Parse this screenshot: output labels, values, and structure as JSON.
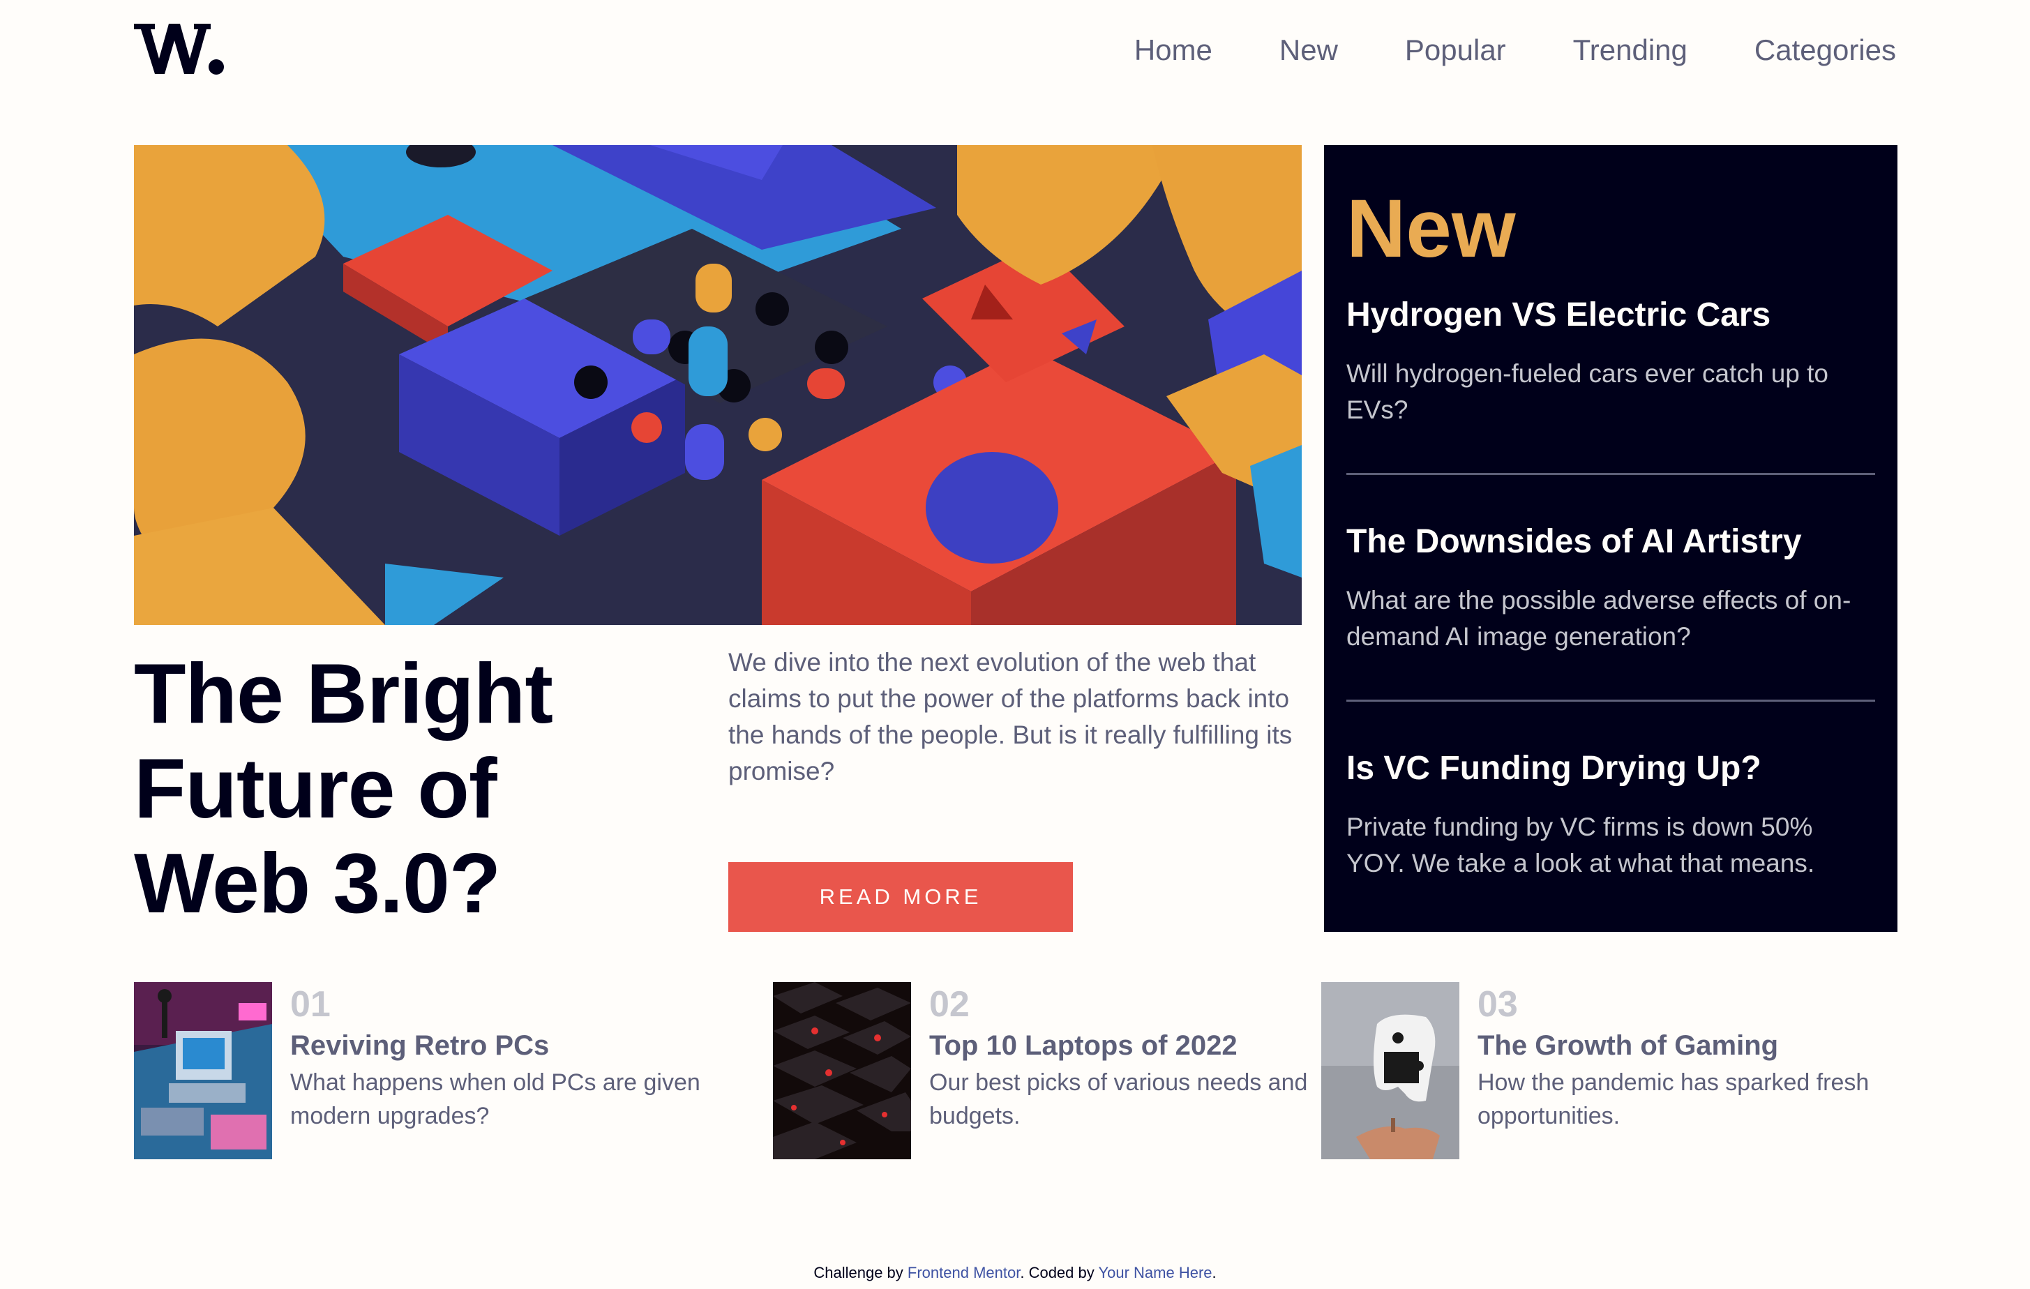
{
  "header": {
    "logo_text": "W.",
    "nav": [
      "Home",
      "New",
      "Popular",
      "Trending",
      "Categories"
    ]
  },
  "hero": {
    "image_icon": "abstract-3d-blocks-image",
    "title": "The Bright Future of Web 3.0?",
    "description": "We dive into the next evolution of the web that claims to put the power of the platforms back into the hands of the people. But is it really fulfilling its promise?",
    "button_label": "READ MORE"
  },
  "new_panel": {
    "heading": "New",
    "items": [
      {
        "title": "Hydrogen VS Electric Cars",
        "text": "Will hydrogen-fueled cars ever catch up to EVs?"
      },
      {
        "title": "The Downsides of AI Artistry",
        "text": "What are the possible adverse effects of on-demand AI image generation?"
      },
      {
        "title": "Is VC Funding Drying Up?",
        "text": "Private funding by VC firms is down 50% YOY. We take a look at what that means."
      }
    ]
  },
  "bottom": [
    {
      "num": "01",
      "title": "Reviving Retro PCs",
      "text": "What happens when old PCs are given modern upgrades?",
      "image_icon": "retro-pc-image"
    },
    {
      "num": "02",
      "title": "Top 10 Laptops of 2022",
      "text": "Our best picks of various needs and budgets.",
      "image_icon": "keyboard-image"
    },
    {
      "num": "03",
      "title": "The Growth of Gaming",
      "text": "How the pandemic has sparked fresh opportunities.",
      "image_icon": "gamepad-image"
    }
  ],
  "footer": {
    "prefix": "Challenge by ",
    "link1": "Frontend Mentor",
    "middle": ". Coded by ",
    "link2": "Your Name Here",
    "suffix": "."
  },
  "colors": {
    "background": "#fffdfa",
    "dark": "#00001a",
    "accent_red": "#e9564c",
    "accent_orange": "#e9ab53",
    "grayish_blue": "#5d5f79",
    "light_gray": "#c5c6ce"
  }
}
